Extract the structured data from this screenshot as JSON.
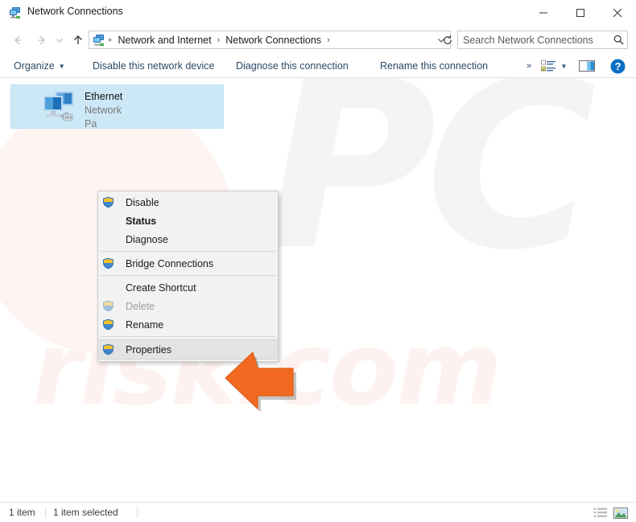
{
  "window": {
    "title": "Network Connections",
    "icon": "network-connections-icon",
    "controls": {
      "minimize": "minimize-button",
      "maximize": "maximize-button",
      "close": "close-button"
    }
  },
  "address_bar": {
    "back": "back-button",
    "forward": "forward-button",
    "recent": "recent-locations-button",
    "up": "up-button",
    "icon": "network-connections-icon",
    "crumbs": [
      "Network and Internet",
      "Network Connections"
    ],
    "trailing_separator": "›",
    "separator": "›",
    "dropdown": "address-dropdown",
    "refresh": "refresh-button"
  },
  "search": {
    "placeholder": "Search Network Connections",
    "value": "",
    "icon": "search-icon"
  },
  "command_bar": {
    "organize": "Organize",
    "disable_device": "Disable this network device",
    "diagnose_connection": "Diagnose this connection",
    "rename_connection": "Rename this connection",
    "overflow": "»",
    "view_options": "change-view-button",
    "preview_pane": "preview-pane-button",
    "help": "help-button"
  },
  "connection": {
    "name": "Ethernet",
    "network": "Network",
    "adapter": "Pa",
    "icon": "ethernet-adapter-icon",
    "selected": true
  },
  "context_menu": {
    "items": [
      {
        "label": "Disable",
        "shield": true,
        "bold": false,
        "disabled": false,
        "hover": false
      },
      {
        "label": "Status",
        "shield": false,
        "bold": true,
        "disabled": false,
        "hover": false
      },
      {
        "label": "Diagnose",
        "shield": false,
        "bold": false,
        "disabled": false,
        "hover": false
      },
      {
        "separator": true
      },
      {
        "label": "Bridge Connections",
        "shield": true,
        "bold": false,
        "disabled": false,
        "hover": false
      },
      {
        "separator": true
      },
      {
        "label": "Create Shortcut",
        "shield": false,
        "bold": false,
        "disabled": false,
        "hover": false
      },
      {
        "label": "Delete",
        "shield": true,
        "bold": false,
        "disabled": true,
        "hover": false
      },
      {
        "label": "Rename",
        "shield": true,
        "bold": false,
        "disabled": false,
        "hover": false
      },
      {
        "separator": true
      },
      {
        "label": "Properties",
        "shield": true,
        "bold": false,
        "disabled": false,
        "hover": true
      }
    ]
  },
  "status_bar": {
    "item_count": "1 item",
    "selected_count": "1 item selected",
    "details_view": "details-view-button",
    "tiles_view": "large-icons-view-button"
  },
  "watermark": {
    "top": "PC",
    "bottom": "risk.com"
  },
  "colors": {
    "selection": "#cce8f7",
    "accent": "#0078d7",
    "cursor": "#f26a21",
    "command_text": "#2b4a66"
  }
}
